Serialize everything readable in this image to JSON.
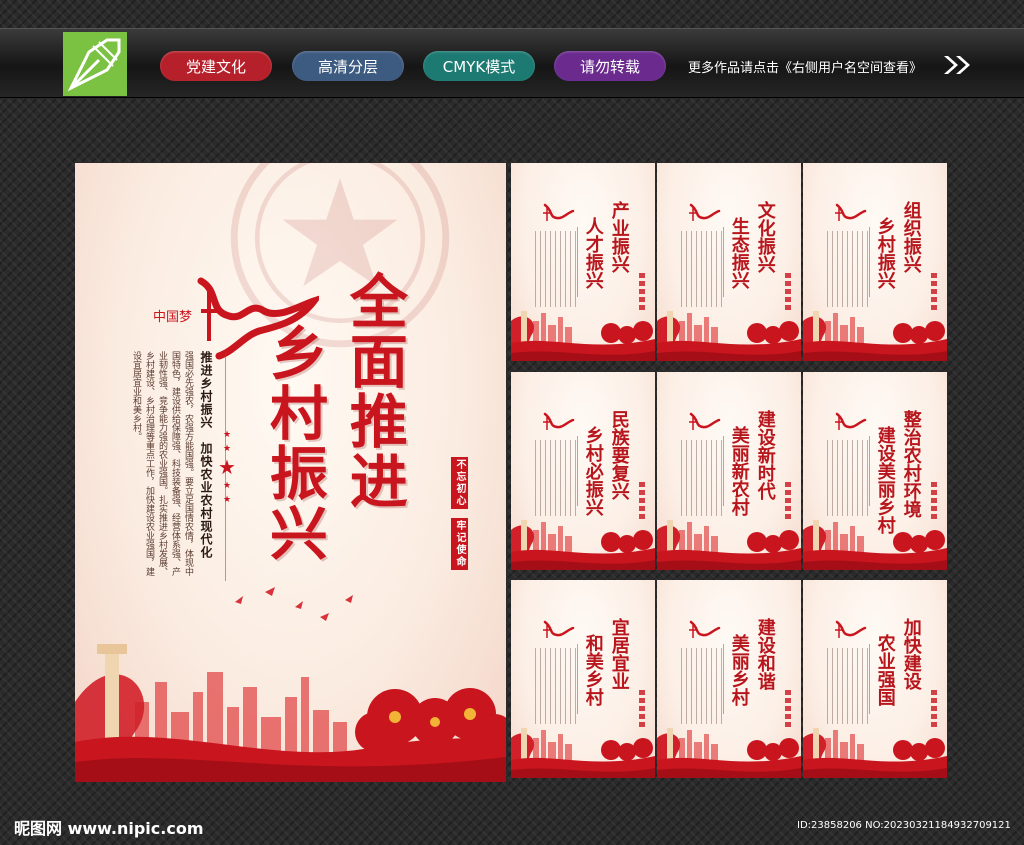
{
  "header": {
    "tags": [
      {
        "label": "党建文化",
        "color": "#b5202a"
      },
      {
        "label": "高清分层",
        "color": "#3d5a80"
      },
      {
        "label": "CMYK模式",
        "color": "#1c7a72"
      },
      {
        "label": "请勿转载",
        "color": "#6a2a8e"
      }
    ],
    "right_text": "更多作品请点击《右侧用户名空间查看》",
    "logo_icon": "pen-nib-icon",
    "arrow_icon": "double-chevron-right-icon"
  },
  "main_poster": {
    "title_col1": "全面推进",
    "title_col2": "乡村振兴",
    "subtitle": "推进乡村振兴　加快农业农村现代化",
    "body": "强国必先强农，农强方能国强。要立足国情农情，体现中国特色，建设供给保障强、科技装备强、经营体系强、产业韧性强、竞争能力强的农业强国。扎实推进乡村发展、乡村建设、乡村治理等重点工作，加快建设农业强国，建设宜居宜业和美乡村。",
    "seal_box_1": "不忘初心",
    "seal_box_2": "牢记使命",
    "logo_text": "中国梦",
    "accent_color": "#c9151e"
  },
  "small_posters": [
    {
      "line1": "产业振兴",
      "line2": "人才振兴"
    },
    {
      "line1": "文化振兴",
      "line2": "生态振兴"
    },
    {
      "line1": "组织振兴",
      "line2": "乡村振兴"
    },
    {
      "line1": "民族要复兴",
      "line2": "乡村必振兴"
    },
    {
      "line1": "建设新时代",
      "line2": "美丽新农村"
    },
    {
      "line1": "整治农村环境",
      "line2": "建设美丽乡村"
    },
    {
      "line1": "宜居宜业",
      "line2": "和美乡村"
    },
    {
      "line1": "建设和谐",
      "line2": "美丽乡村"
    },
    {
      "line1": "加快建设",
      "line2": "农业强国"
    }
  ],
  "footer": {
    "site": "昵图网 www.nipic.com",
    "id_text": "ID:23858206 NO:20230321184932709121"
  }
}
